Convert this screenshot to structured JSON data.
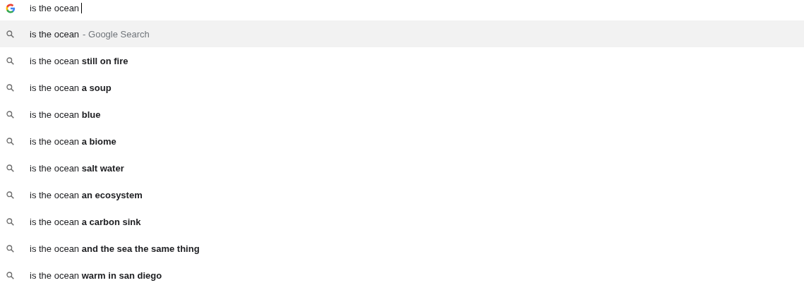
{
  "omnibox": {
    "value": "is the ocean"
  },
  "suggestions": [
    {
      "text": "is the ocean",
      "suffix": "- Google Search",
      "selected": true
    },
    {
      "text": "is the ocean **still on fire**",
      "selected": false
    },
    {
      "text": "is the ocean **a soup**",
      "selected": false
    },
    {
      "text": "is the ocean **blue**",
      "selected": false
    },
    {
      "text": "is the ocean **a biome**",
      "selected": false
    },
    {
      "text": "is the ocean **salt water**",
      "selected": false
    },
    {
      "text": "is the ocean **an ecosystem**",
      "selected": false
    },
    {
      "text": "is the ocean **a carbon sink**",
      "selected": false
    },
    {
      "text": "is the ocean **and the sea the same thing**",
      "selected": false
    },
    {
      "text": "is the ocean **warm in san diego**",
      "selected": false
    }
  ]
}
